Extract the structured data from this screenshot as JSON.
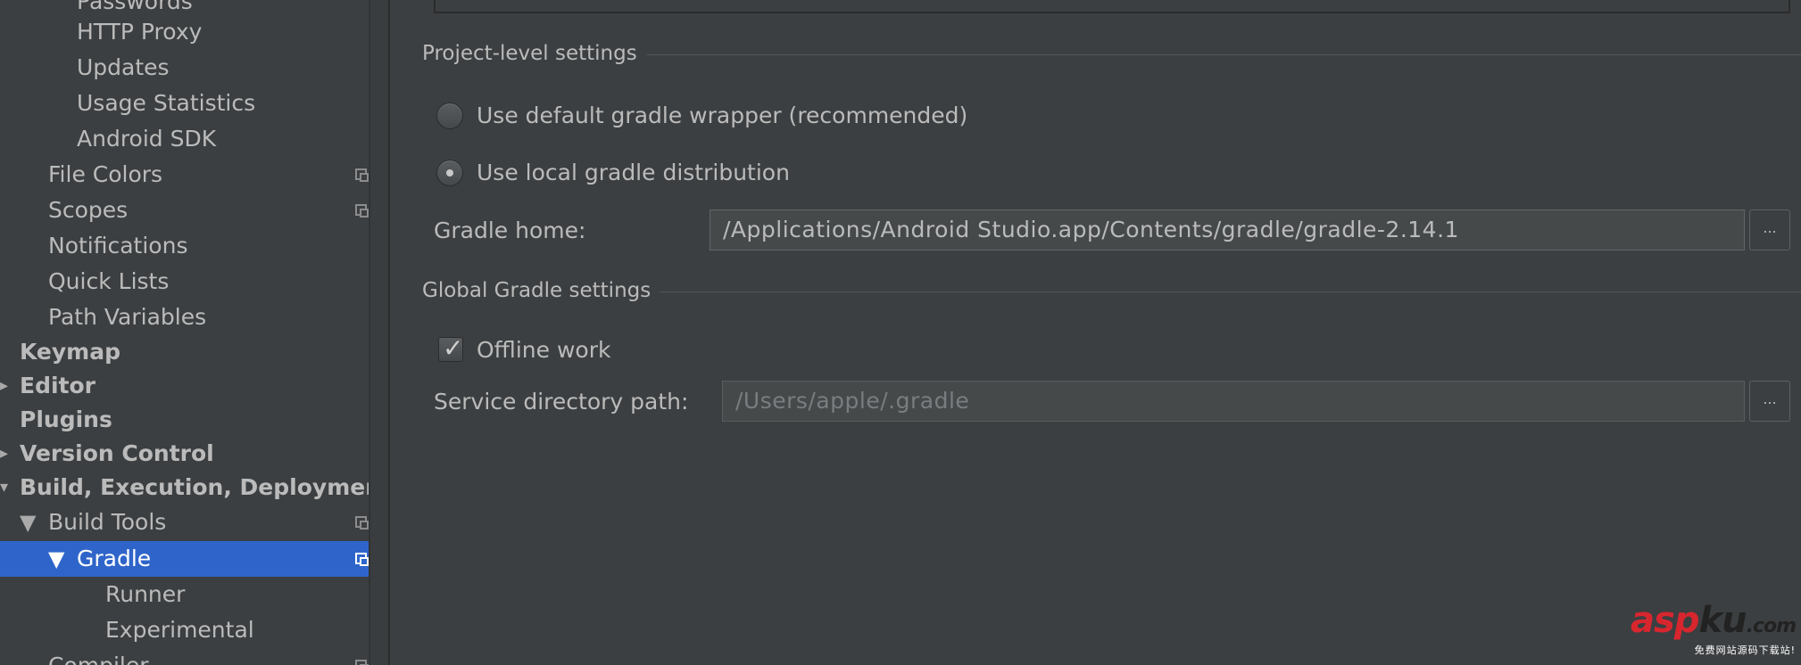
{
  "sidebar": {
    "items": [
      {
        "label": "Passwords"
      },
      {
        "label": "HTTP Proxy"
      },
      {
        "label": "Updates"
      },
      {
        "label": "Usage Statistics"
      },
      {
        "label": "Android SDK"
      },
      {
        "label": "File Colors"
      },
      {
        "label": "Scopes"
      },
      {
        "label": "Notifications"
      },
      {
        "label": "Quick Lists"
      },
      {
        "label": "Path Variables"
      },
      {
        "label": "Keymap"
      },
      {
        "label": "Editor"
      },
      {
        "label": "Plugins"
      },
      {
        "label": "Version Control"
      },
      {
        "label": "Build, Execution, Deployment"
      },
      {
        "label": "Build Tools"
      },
      {
        "label": "Gradle"
      },
      {
        "label": "Runner"
      },
      {
        "label": "Experimental"
      },
      {
        "label": "Compiler"
      }
    ],
    "selected": "Gradle"
  },
  "project_settings": {
    "title": "Project-level settings",
    "option_default_wrapper": "Use default gradle wrapper (recommended)",
    "option_local_distribution": "Use local gradle distribution",
    "selected_option": "Use local gradle distribution",
    "gradle_home_label": "Gradle home:",
    "gradle_home_value": "/Applications/Android Studio.app/Contents/gradle/gradle-2.14.1",
    "browse_label": "..."
  },
  "global_settings": {
    "title": "Global Gradle settings",
    "offline_work_label": "Offline work",
    "offline_work_checked": true,
    "service_dir_label": "Service directory path:",
    "service_dir_placeholder": "/Users/apple/.gradle",
    "browse_label": "..."
  },
  "watermark": {
    "brand_part1": "asp",
    "brand_part2": "ku",
    "brand_part3": ".com",
    "tagline": "免费网站源码下载站!"
  },
  "colors": {
    "background": "#3c3f41",
    "selection": "#2f65ca",
    "text": "#bbbbbb"
  }
}
